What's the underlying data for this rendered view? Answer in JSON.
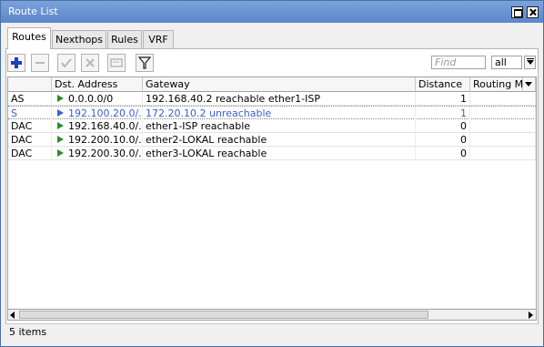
{
  "window": {
    "title": "Route List"
  },
  "tabs": [
    {
      "label": "Routes",
      "active": true
    },
    {
      "label": "Nexthops",
      "active": false
    },
    {
      "label": "Rules",
      "active": false
    },
    {
      "label": "VRF",
      "active": false
    }
  ],
  "toolbar": {
    "icons": [
      "plus-icon",
      "minus-icon",
      "check-icon",
      "cross-icon",
      "comment-icon",
      "filter-icon"
    ],
    "find_placeholder": "Find",
    "filter_value": "all"
  },
  "table": {
    "columns": [
      "Dst. Address",
      "Gateway",
      "Distance",
      "Routing Mar"
    ],
    "rows": [
      {
        "flag": "AS",
        "dst": "0.0.0.0/0",
        "gateway": "192.168.40.2 reachable ether1-ISP",
        "distance": "1",
        "routing_mark": "",
        "style": "normal"
      },
      {
        "flag": "S",
        "dst": "192.100.20.0/...",
        "gateway": "172.20.10.2 unreachable",
        "distance": "1",
        "routing_mark": "",
        "style": "blue"
      },
      {
        "flag": "DAC",
        "dst": "192.168.40.0/...",
        "gateway": "ether1-ISP reachable",
        "distance": "0",
        "routing_mark": "",
        "style": "normal"
      },
      {
        "flag": "DAC",
        "dst": "192.200.10.0/...",
        "gateway": "ether2-LOKAL reachable",
        "distance": "0",
        "routing_mark": "",
        "style": "normal"
      },
      {
        "flag": "DAC",
        "dst": "192.200.30.0/...",
        "gateway": "ether3-LOKAL reachable",
        "distance": "0",
        "routing_mark": "",
        "style": "normal"
      }
    ]
  },
  "status": {
    "text": "5 items"
  },
  "colors": {
    "titlebar": "#6a94d2",
    "unreachable": "#3c5fd0",
    "active_arrow": "#2e8b2e",
    "add_icon": "#1f3fbf"
  }
}
